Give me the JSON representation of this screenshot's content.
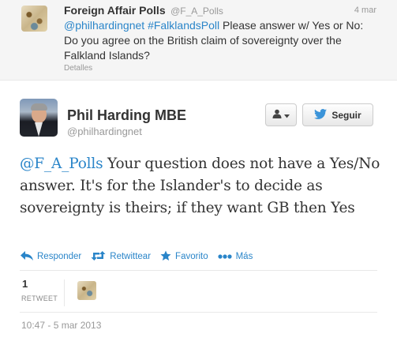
{
  "parent_tweet": {
    "name": "Foreign Affair Polls",
    "handle": "@F_A_Polls",
    "date": "4 mar",
    "mention": "@philhardingnet",
    "hashtag": "#FalklandsPoll",
    "text": " Please answer w/ Yes or No: Do you agree on the British claim of sovereignty over the Falkland Islands?",
    "details_label": "Detalles"
  },
  "main_tweet": {
    "name": "Phil Harding MBE",
    "handle": "@philhardingnet",
    "follow_label": "Seguir",
    "mention": "@F_A_Polls",
    "text": " Your question does not have a Yes/No answer. It's for the Islander's to decide as sovereignty is theirs; if they want GB then Yes",
    "actions": {
      "reply": "Responder",
      "retweet": "Retwittear",
      "favorite": "Favorito",
      "more": "Más"
    },
    "retweet_count": "1",
    "retweet_label": "RETWEET",
    "timestamp": "10:47 - 5 mar 2013"
  },
  "colors": {
    "link": "#2a85c9",
    "twitter_bird": "#3b94d9",
    "muted": "#999999"
  }
}
